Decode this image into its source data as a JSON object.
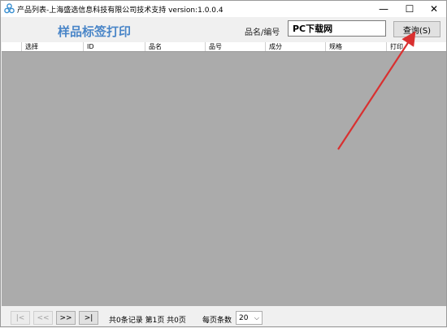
{
  "window": {
    "title": "产品列表-上海盛选信息科技有限公司技术支持 version:1.0.0.4 ",
    "minimize_symbol": "—",
    "maximize_symbol": "☐",
    "close_symbol": "✕"
  },
  "header": {
    "heading": "样品标签打印",
    "field_label": "品名/编号",
    "search_value": "PC下载网",
    "query_button": "查询(S)"
  },
  "grid": {
    "columns": [
      "选择",
      "ID",
      "品名",
      "品号",
      "成分",
      "规格",
      "打印"
    ]
  },
  "pager": {
    "first_label": "|<",
    "prev_label": "<<",
    "next_label": ">>",
    "last_label": ">|",
    "info": "共0条记录 第1页 共0页",
    "page_size_label": "每页条数",
    "page_size": "20"
  },
  "colors": {
    "heading": "#4a86c8",
    "grid_background": "#ababab",
    "annotation_arrow": "#d93030"
  },
  "icons": {
    "app": "app-logo-icon",
    "dropdown": "chevron-down-icon"
  }
}
